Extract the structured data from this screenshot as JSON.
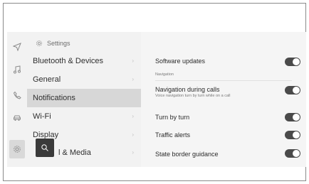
{
  "breadcrumb": {
    "label": "Settings"
  },
  "rail": {
    "icons": [
      "navigation-icon",
      "music-icon",
      "phone-icon",
      "car-icon",
      "settings-gear-icon"
    ]
  },
  "list": {
    "items": [
      {
        "label": "Bluetooth & Devices"
      },
      {
        "label": "General"
      },
      {
        "label": "Notifications"
      },
      {
        "label": "Wi-Fi"
      },
      {
        "label": "Display"
      },
      {
        "label": "l & Media"
      }
    ],
    "selected_index": 2
  },
  "panel": {
    "software_updates": {
      "label": "Software updates",
      "on": true
    },
    "section_navigation": "Navigation",
    "nav_during_calls": {
      "label": "Navigation during calls",
      "sub": "Voice navigation turn by turn while on a call",
      "on": true
    },
    "turn_by_turn": {
      "label": "Turn by turn",
      "on": true
    },
    "traffic_alerts": {
      "label": "Traffic alerts",
      "on": true
    },
    "state_border": {
      "label": "State border guidance",
      "on": true
    }
  },
  "colors": {
    "toggle_on": "#4a4a4a",
    "selected_row": "#d7d7d7",
    "background": "#f2f2f2"
  }
}
